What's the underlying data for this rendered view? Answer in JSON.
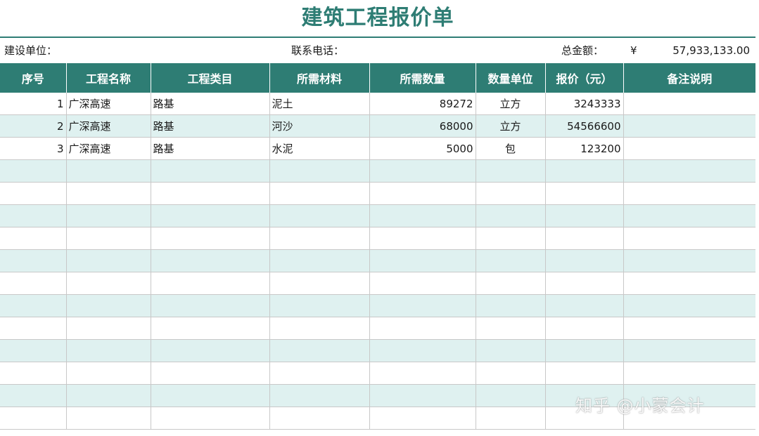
{
  "title": "建筑工程报价单",
  "info": {
    "client_label": "建设单位：",
    "phone_label": "联系电话：",
    "total_label": "总金额：",
    "currency": "¥",
    "total_value": "57,933,133.00"
  },
  "columns": [
    "序号",
    "工程名称",
    "工程类目",
    "所需材料",
    "所需数量",
    "数量单位",
    "报价（元）",
    "备注说明"
  ],
  "rows": [
    {
      "no": "1",
      "project": "广深高速",
      "category": "路基",
      "material": "泥土",
      "qty": "89272",
      "unit": "立方",
      "price": "3243333",
      "note": ""
    },
    {
      "no": "2",
      "project": "广深高速",
      "category": "路基",
      "material": "河沙",
      "qty": "68000",
      "unit": "立方",
      "price": "54566600",
      "note": ""
    },
    {
      "no": "3",
      "project": "广深高速",
      "category": "路基",
      "material": "水泥",
      "qty": "5000",
      "unit": "包",
      "price": "123200",
      "note": ""
    }
  ],
  "watermark": "知乎 @小蒙会计",
  "colors": {
    "accent": "#2e7d74",
    "stripe": "#dff1f0",
    "grid": "#c8c8c8"
  }
}
